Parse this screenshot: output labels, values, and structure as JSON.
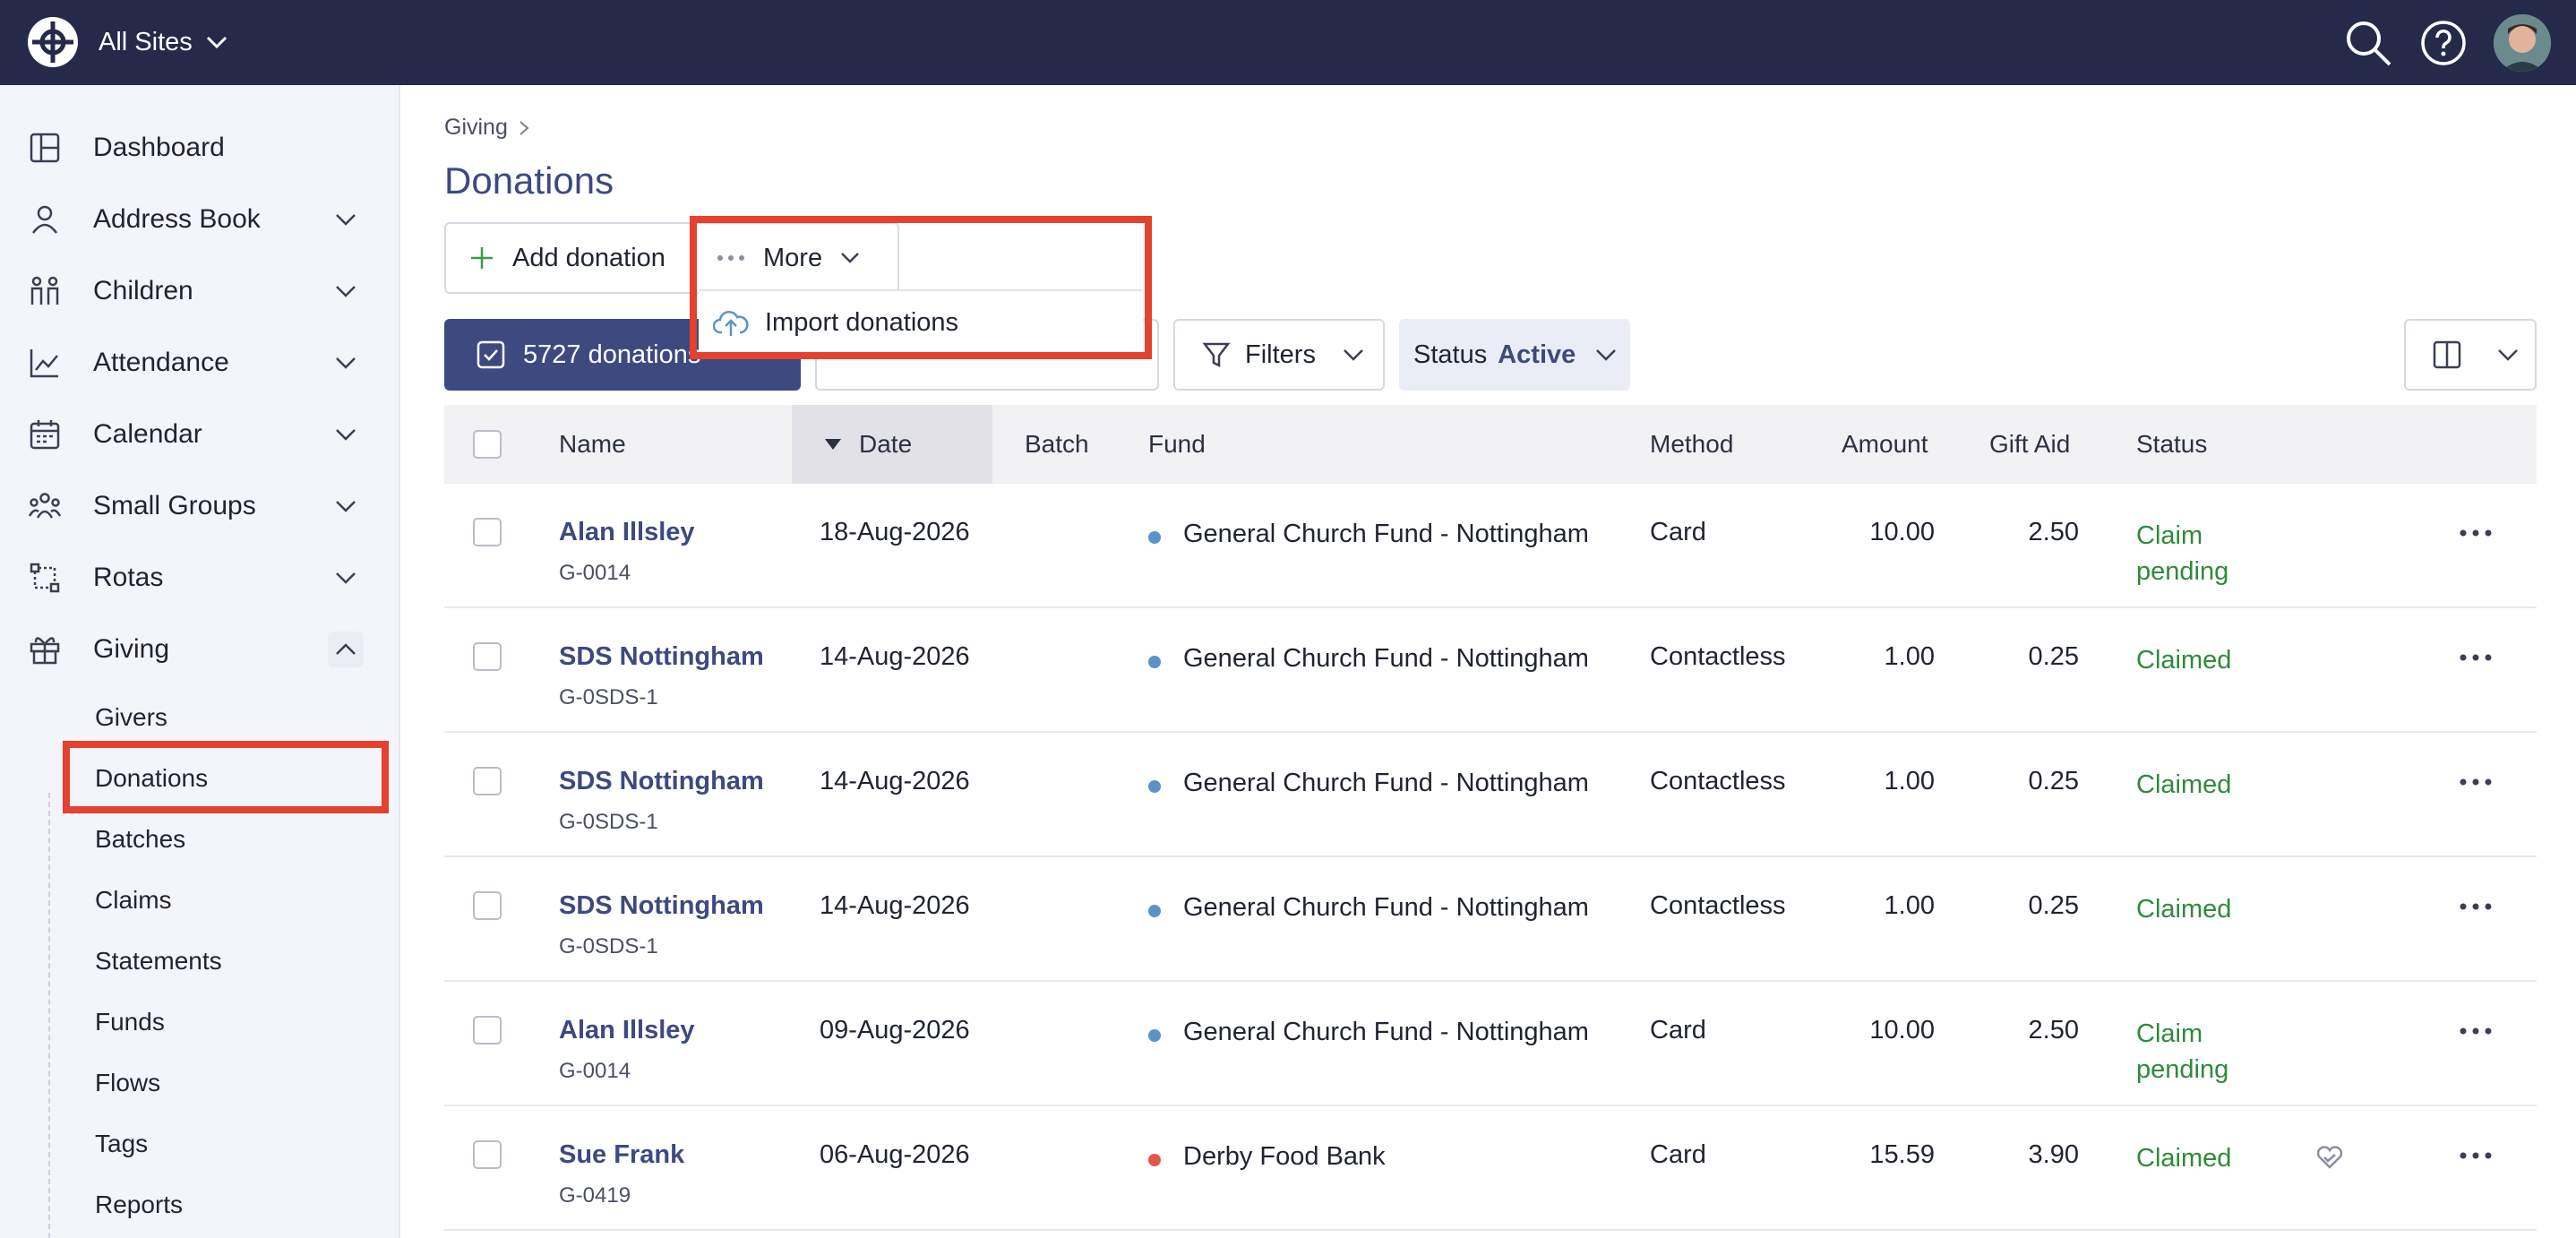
{
  "topbar": {
    "site_switch": "All Sites",
    "icons": [
      "logo-icon",
      "search-icon",
      "help-icon",
      "avatar"
    ]
  },
  "sidebar": {
    "items": [
      {
        "label": "Dashboard",
        "icon": "dashboard-icon"
      },
      {
        "label": "Address Book",
        "icon": "person-icon"
      },
      {
        "label": "Children",
        "icon": "children-icon"
      },
      {
        "label": "Attendance",
        "icon": "chart-icon"
      },
      {
        "label": "Calendar",
        "icon": "calendar-icon"
      },
      {
        "label": "Small Groups",
        "icon": "groups-icon"
      },
      {
        "label": "Rotas",
        "icon": "rotas-icon"
      },
      {
        "label": "Giving",
        "icon": "gift-icon"
      }
    ],
    "giving_sub": [
      "Givers",
      "Donations",
      "Batches",
      "Claims",
      "Statements",
      "Funds",
      "Flows",
      "Tags",
      "Reports"
    ]
  },
  "main": {
    "breadcrumb": "Giving",
    "title": "Donations",
    "add_label": "Add donation",
    "more_label": "More",
    "dropdown_item": "Import donations",
    "selection_label": "5727 donations",
    "filters_label": "Filters",
    "status_prefix": "Status",
    "status_value": "Active"
  },
  "table": {
    "headers": {
      "name": "Name",
      "date": "Date",
      "batch": "Batch",
      "fund": "Fund",
      "method": "Method",
      "amount": "Amount",
      "gift_aid": "Gift Aid",
      "status": "Status"
    },
    "rows": [
      {
        "name": "Alan Illsley",
        "ref": "G-0014",
        "date": "18-Aug-2026",
        "fund": "General Church Fund - Nottingham",
        "fund_color": "#5b93c9",
        "method": "Card",
        "amount": "10.00",
        "gift_aid": "2.50",
        "status": "Claim pending"
      },
      {
        "name": "SDS Nottingham",
        "ref": "G-0SDS-1",
        "date": "14-Aug-2026",
        "fund": "General Church Fund - Nottingham",
        "fund_color": "#5b93c9",
        "method": "Contactless",
        "amount": "1.00",
        "gift_aid": "0.25",
        "status": "Claimed"
      },
      {
        "name": "SDS Nottingham",
        "ref": "G-0SDS-1",
        "date": "14-Aug-2026",
        "fund": "General Church Fund - Nottingham",
        "fund_color": "#5b93c9",
        "method": "Contactless",
        "amount": "1.00",
        "gift_aid": "0.25",
        "status": "Claimed"
      },
      {
        "name": "SDS Nottingham",
        "ref": "G-0SDS-1",
        "date": "14-Aug-2026",
        "fund": "General Church Fund - Nottingham",
        "fund_color": "#5b93c9",
        "method": "Contactless",
        "amount": "1.00",
        "gift_aid": "0.25",
        "status": "Claimed"
      },
      {
        "name": "Alan Illsley",
        "ref": "G-0014",
        "date": "09-Aug-2026",
        "fund": "General Church Fund - Nottingham",
        "fund_color": "#5b93c9",
        "method": "Card",
        "amount": "10.00",
        "gift_aid": "2.50",
        "status": "Claim pending"
      },
      {
        "name": "Sue Frank",
        "ref": "G-0419",
        "date": "06-Aug-2026",
        "fund": "Derby Food Bank",
        "fund_color": "#e2564a",
        "method": "Card",
        "amount": "15.59",
        "gift_aid": "3.90",
        "status": "Claimed",
        "extra_icon": "heart-hand-icon"
      }
    ]
  },
  "colors": {
    "topbar": "#252a4a",
    "accent": "#3d4a80",
    "highlight": "#e4412e",
    "claimed": "#2f8a3a"
  }
}
